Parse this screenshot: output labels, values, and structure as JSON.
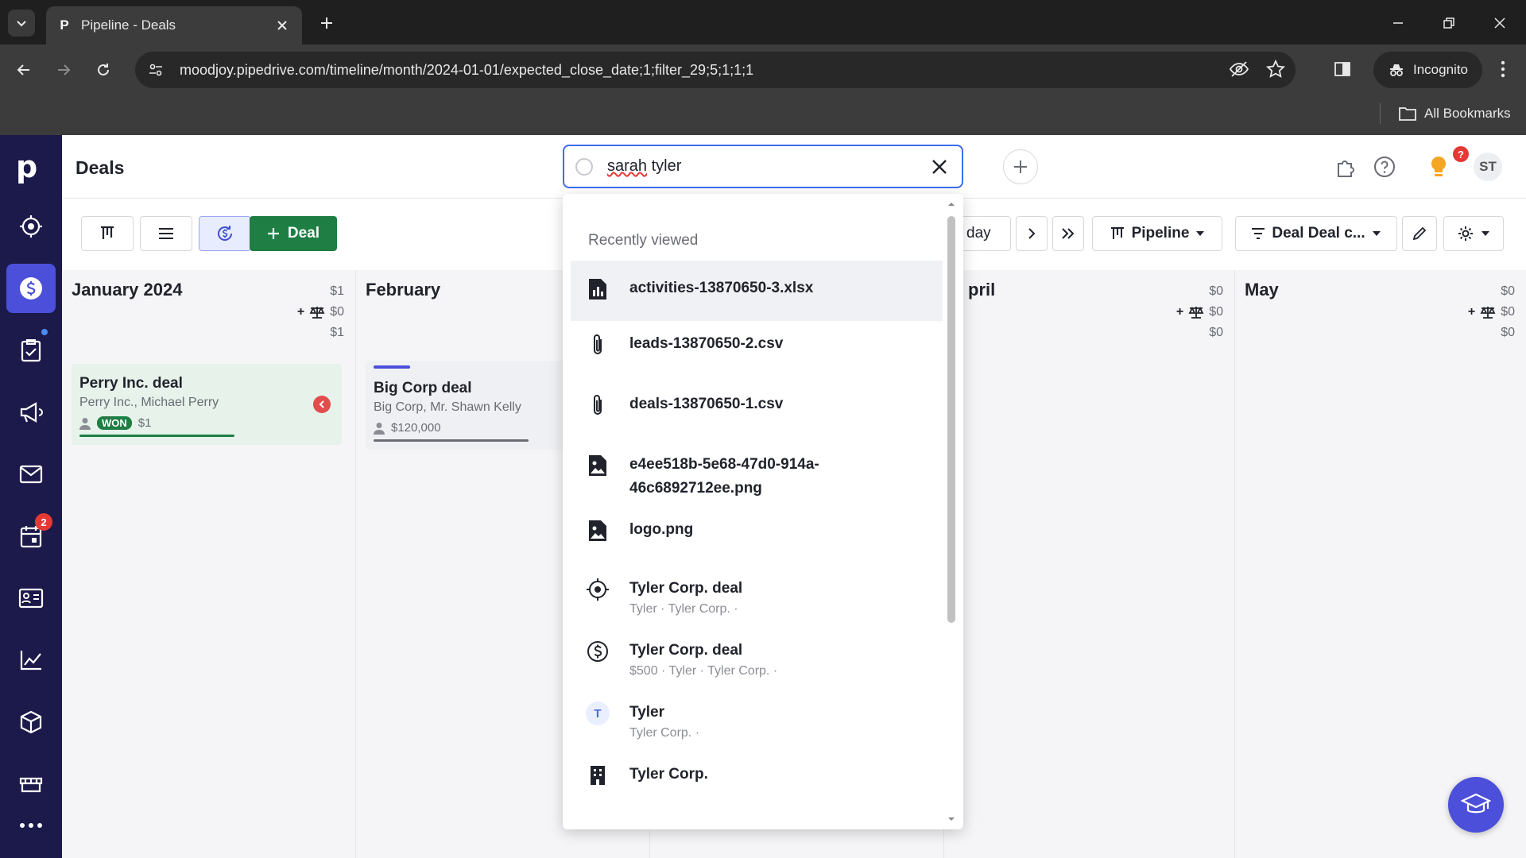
{
  "browser": {
    "tab_title": "Pipeline - Deals",
    "tab_favicon": "P",
    "url": "moodjoy.pipedrive.com/timeline/month/2024-01-01/expected_close_date;1;filter_29;5;1;1;1",
    "incognito_label": "Incognito",
    "all_bookmarks_label": "All Bookmarks"
  },
  "sidebar": {
    "logo": "p",
    "items": [
      {
        "name": "leads",
        "icon": "target-icon"
      },
      {
        "name": "deals",
        "icon": "dollar-icon",
        "active": true
      },
      {
        "name": "activities",
        "icon": "checklist-icon"
      },
      {
        "name": "campaigns",
        "icon": "megaphone-icon"
      },
      {
        "name": "mail",
        "icon": "mail-icon"
      },
      {
        "name": "calendar",
        "icon": "calendar-icon",
        "badge": "2"
      },
      {
        "name": "contacts",
        "icon": "contact-card-icon"
      },
      {
        "name": "insights",
        "icon": "chart-icon"
      },
      {
        "name": "products",
        "icon": "box-icon"
      },
      {
        "name": "marketplace",
        "icon": "store-icon"
      },
      {
        "name": "more",
        "icon": "more-icon"
      }
    ]
  },
  "header": {
    "title": "Deals",
    "tips_badge": "?",
    "avatar_initials": "ST"
  },
  "search": {
    "query_word1": "sarah",
    "query_word2": " tyler"
  },
  "toolbar": {
    "add_deal_label": "Deal",
    "today_label": "day",
    "pipeline_label": "Pipeline",
    "filter_label": "Deal Deal c..."
  },
  "columns": [
    {
      "title": "January 2024",
      "stat1": "$1",
      "stat2": "$0",
      "stat3": "$1"
    },
    {
      "title": "February",
      "stat2": ""
    },
    {
      "title": "pril",
      "stat1": "$0",
      "stat2": "$0",
      "stat3": "$0"
    },
    {
      "title": "May",
      "stat1": "$0",
      "stat2": "$0",
      "stat3": "$0"
    }
  ],
  "cards": [
    {
      "title": "Perry Inc. deal",
      "subtitle": "Perry Inc., Michael Perry",
      "badge": "WON",
      "value": "$1"
    },
    {
      "title": "Big Corp deal",
      "subtitle": "Big Corp, Mr. Shawn Kelly",
      "value": "$120,000"
    }
  ],
  "dropdown": {
    "heading": "Recently viewed",
    "items": [
      {
        "icon": "spreadsheet-file-icon",
        "title": "activities-13870650-3.xlsx"
      },
      {
        "icon": "paperclip-icon",
        "title": "leads-13870650-2.csv"
      },
      {
        "icon": "paperclip-icon",
        "title": "deals-13870650-1.csv"
      },
      {
        "icon": "image-file-icon",
        "title_line1": "e4ee518b-5e68-47d0-914a-",
        "title_line2": "46c6892712ee.png"
      },
      {
        "icon": "image-file-icon",
        "title": "logo.png"
      },
      {
        "icon": "target-icon",
        "title": "Tyler Corp. deal",
        "subtitle": "Tyler  ·  Tyler Corp.  ·"
      },
      {
        "icon": "dollar-icon",
        "title": "Tyler Corp. deal",
        "subtitle": "$500  ·  Tyler  ·  Tyler Corp.  ·"
      },
      {
        "icon": "person-letter-icon",
        "letter": "T",
        "title": "Tyler",
        "subtitle": "Tyler Corp.  ·"
      },
      {
        "icon": "building-icon",
        "title": "Tyler Corp."
      }
    ]
  }
}
